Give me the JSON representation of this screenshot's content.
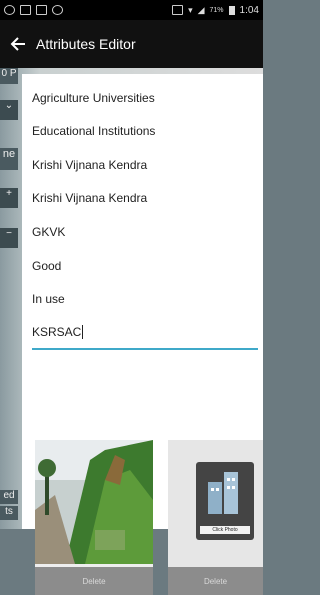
{
  "status_bar": {
    "battery": "71%",
    "time": "1:04"
  },
  "header": {
    "title": "Attributes Editor"
  },
  "background": {
    "left_labels": [
      "0 P",
      "ne",
      "ed",
      "ts"
    ]
  },
  "fields": [
    {
      "value": "Agriculture Universities"
    },
    {
      "value": "Educational Institutions"
    },
    {
      "value": "Krishi Vijnana Kendra"
    },
    {
      "value": "Krishi Vijnana Kendra"
    },
    {
      "value": "GKVK"
    },
    {
      "value": "Good"
    },
    {
      "value": "In use"
    },
    {
      "value": "KSRSAC"
    }
  ],
  "photos": [
    {
      "delete_label": "Delete"
    },
    {
      "delete_label": "Delete",
      "click_photo_label": "Click Photo"
    }
  ],
  "colors": {
    "accent": "#3fa9c9",
    "app_bar": "#111111",
    "delete_bar": "#8c8c8c"
  }
}
